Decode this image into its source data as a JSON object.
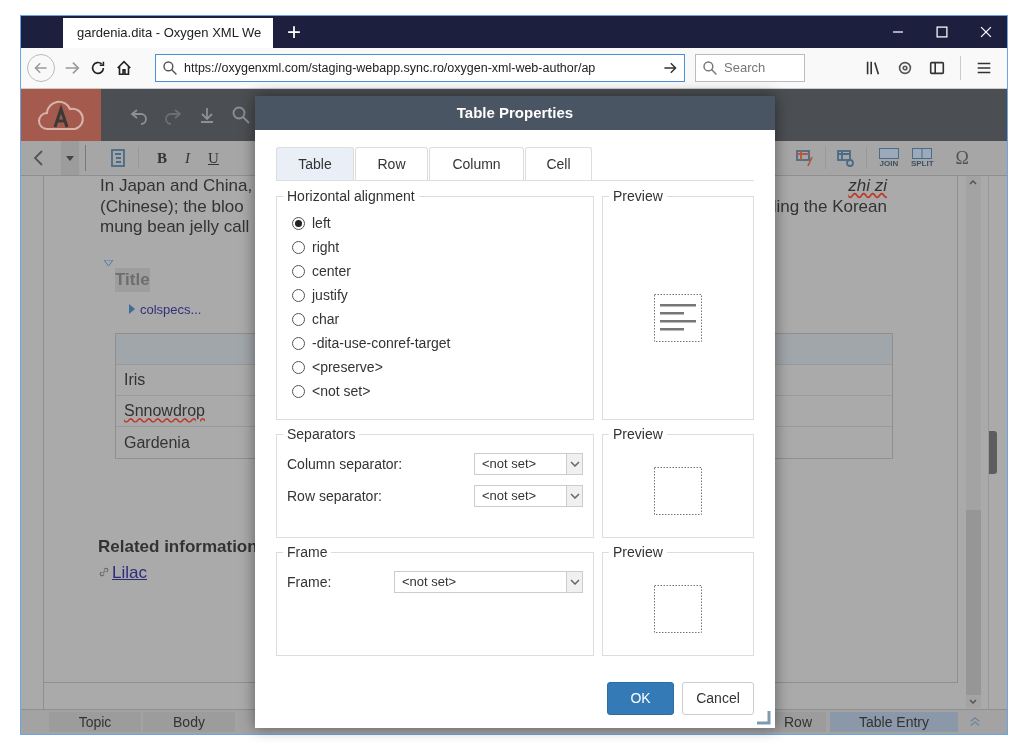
{
  "browser": {
    "tab_title": "gardenia.dita - Oxygen XML We",
    "new_tab": "+",
    "url": "https://oxygenxml.com/staging-webapp.sync.ro/oxygen-xml-web-author/ap",
    "search_placeholder": "Search"
  },
  "editor_toolbar": {
    "format_buttons": [
      "B",
      "I",
      "U"
    ],
    "table_buttons": [
      "JOIN",
      "SPLIT"
    ],
    "symbol_button": "Ω"
  },
  "document": {
    "lines": [
      {
        "left": "In Japan and China,",
        "right": "zhi zi"
      },
      {
        "left": "(Chinese); the bloo",
        "right": "ling the Korean"
      },
      {
        "left": "mung bean jelly call"
      }
    ],
    "title": "Title",
    "colspecs": "colspecs...",
    "table_rows": [
      {
        "text": "Iris",
        "misspelled": false
      },
      {
        "text": "Snnowdrop",
        "misspelled": true
      },
      {
        "text": "Gardenia",
        "misspelled": false
      }
    ],
    "related_heading": "Related information",
    "related_link": "Lilac"
  },
  "breadcrumbs": [
    {
      "label": "Topic",
      "selected": false
    },
    {
      "label": "Body",
      "selected": false
    },
    {
      "label": "Row",
      "selected": false
    },
    {
      "label": "Table Entry",
      "selected": true
    }
  ],
  "dialog": {
    "title": "Table Properties",
    "tabs": [
      {
        "label": "Table",
        "selected": true
      },
      {
        "label": "Row",
        "selected": false
      },
      {
        "label": "Column",
        "selected": false
      },
      {
        "label": "Cell",
        "selected": false
      }
    ],
    "horizontal_alignment": {
      "legend": "Horizontal alignment",
      "options": [
        {
          "label": "left",
          "selected": true
        },
        {
          "label": "right",
          "selected": false
        },
        {
          "label": "center",
          "selected": false
        },
        {
          "label": "justify",
          "selected": false
        },
        {
          "label": "char",
          "selected": false
        },
        {
          "label": "-dita-use-conref-target",
          "selected": false
        },
        {
          "label": "<preserve>",
          "selected": false
        },
        {
          "label": "<not set>",
          "selected": false
        }
      ]
    },
    "separators": {
      "legend": "Separators",
      "fields": [
        {
          "label": "Column separator:",
          "value": "<not set>"
        },
        {
          "label": "Row separator:",
          "value": "<not set>"
        }
      ]
    },
    "frame": {
      "legend": "Frame",
      "fields": [
        {
          "label": "Frame:",
          "value": "<not set>"
        }
      ]
    },
    "preview_legends": [
      "Preview",
      "Preview",
      "Preview"
    ],
    "buttons": [
      {
        "label": "OK",
        "kind": "primary"
      },
      {
        "label": "Cancel",
        "kind": "secondary"
      }
    ]
  }
}
